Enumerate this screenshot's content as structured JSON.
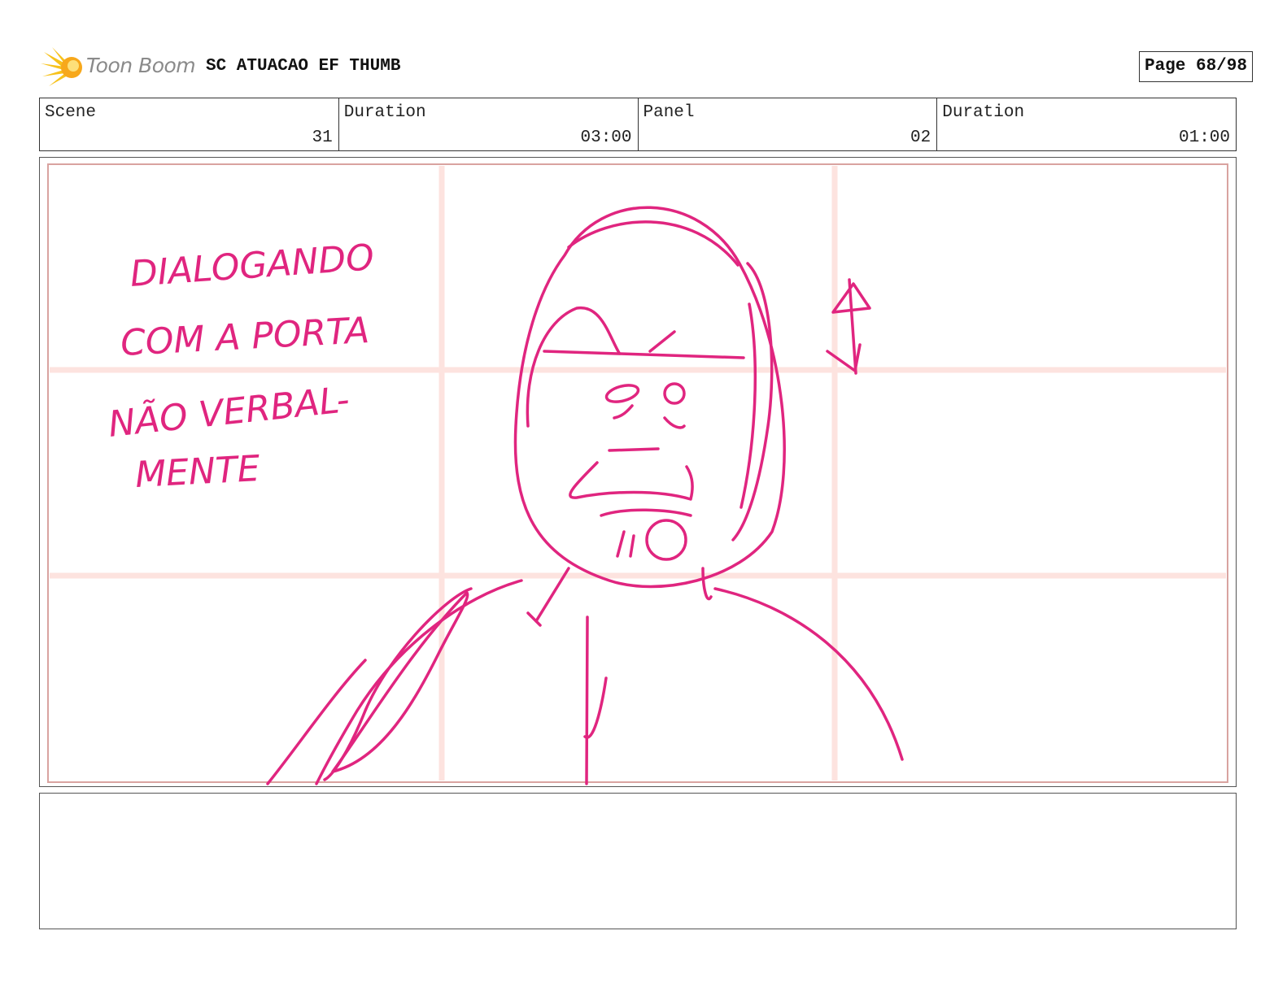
{
  "header": {
    "brand": "Toon Boom",
    "title": "SC ATUACAO EF THUMB",
    "page": "Page 68/98"
  },
  "info": [
    {
      "label": "Scene",
      "value": "31"
    },
    {
      "label": "Duration",
      "value": "03:00"
    },
    {
      "label": "Panel",
      "value": "02"
    },
    {
      "label": "Duration",
      "value": "01:00"
    }
  ],
  "panel": {
    "handwritten_note": [
      "DIALOGANDO",
      "COM A PORTA",
      "NÃO VERBAL-",
      "MENTE"
    ]
  },
  "notes": {
    "text": ""
  },
  "colors": {
    "sketch": "#e0257f",
    "grid": "#fde3df",
    "safe_frame": "#d9a3a0",
    "logo_yellow": "#f7c21b"
  }
}
